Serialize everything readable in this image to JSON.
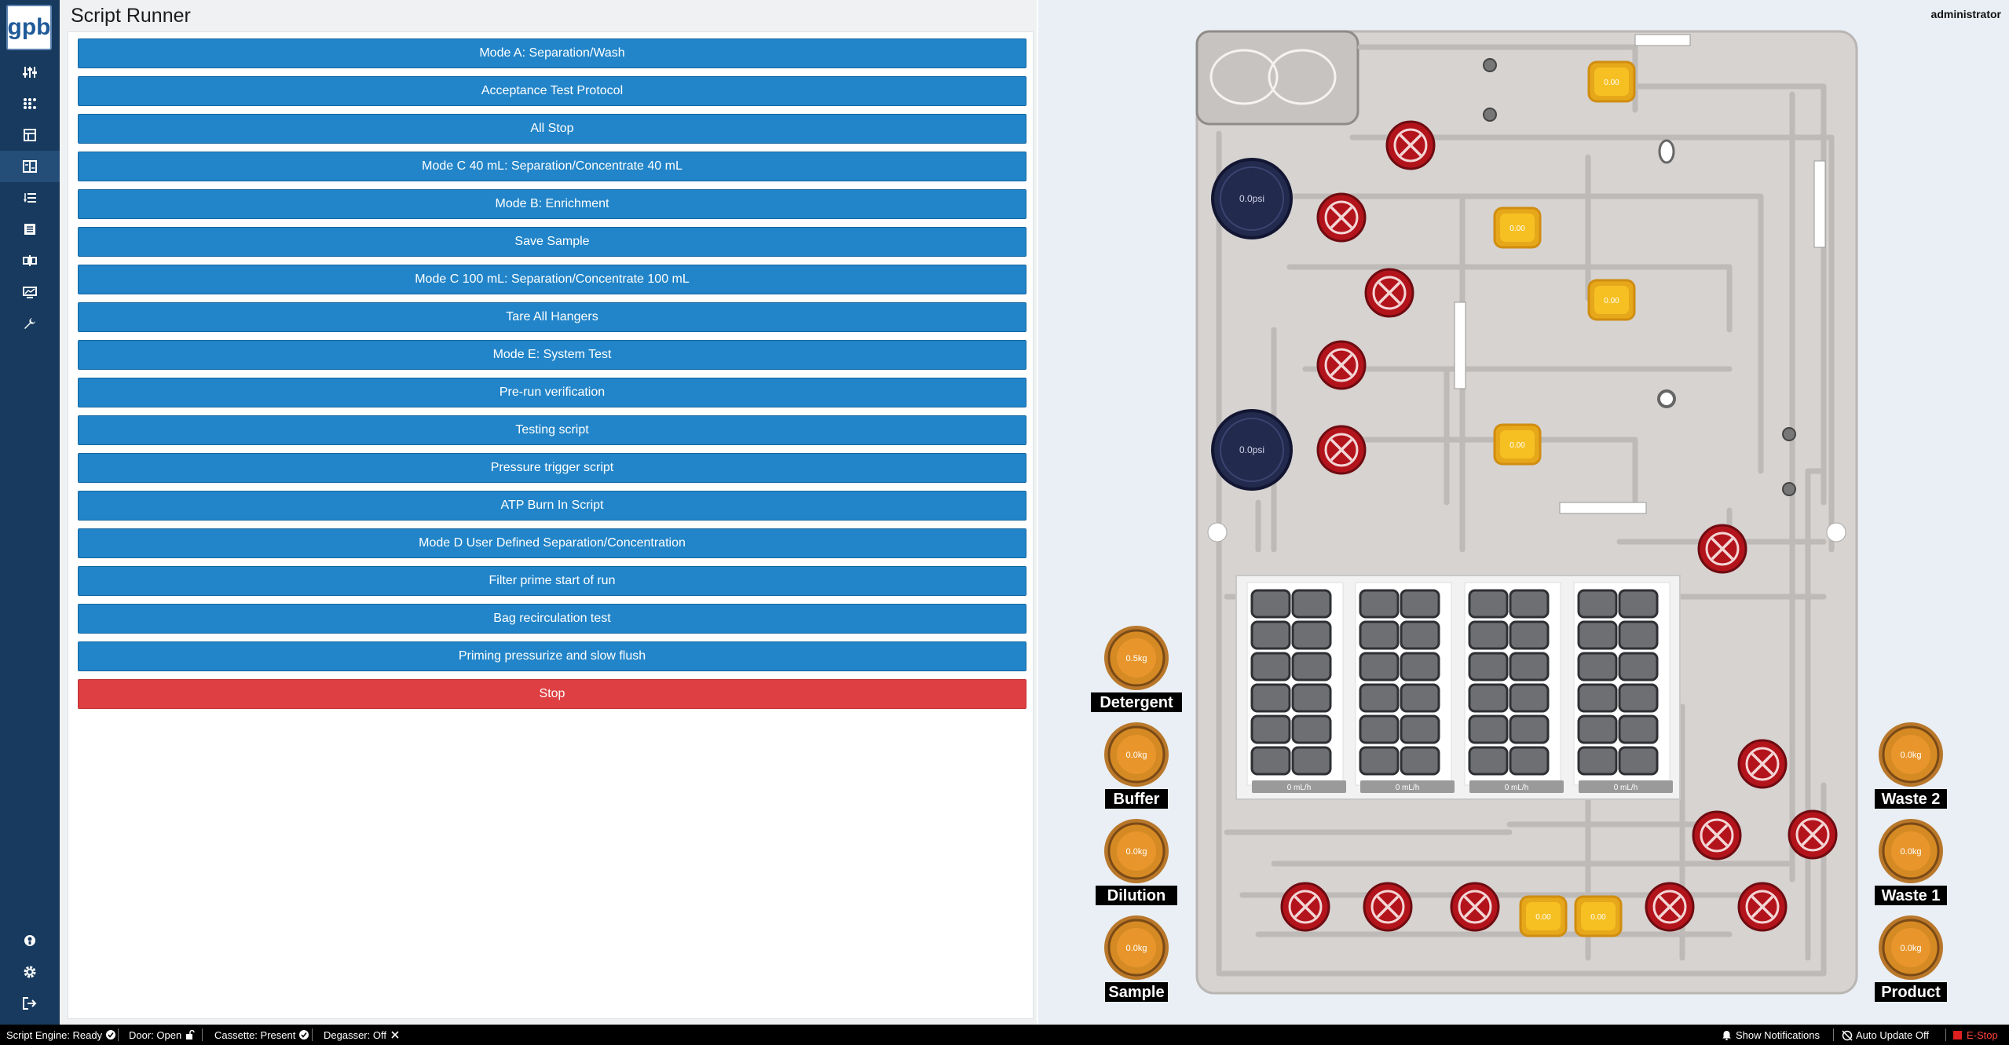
{
  "app": {
    "logo_text": "gpb",
    "title": "Script Runner",
    "user": "administrator"
  },
  "sidebar": {
    "items": [
      {
        "icon": "sliders-icon"
      },
      {
        "icon": "grid-dots-icon"
      },
      {
        "icon": "table-icon"
      },
      {
        "icon": "script-runner-icon",
        "active": true
      },
      {
        "icon": "list-order-icon"
      },
      {
        "icon": "document-list-icon"
      },
      {
        "icon": "compare-icon"
      },
      {
        "icon": "monitor-chart-icon"
      },
      {
        "icon": "wrench-icon"
      }
    ],
    "bottom_items": [
      {
        "icon": "user-icon"
      },
      {
        "icon": "gear-icon"
      },
      {
        "icon": "logout-icon"
      }
    ]
  },
  "scripts": [
    "Mode A: Separation/Wash",
    "Acceptance Test Protocol",
    "All Stop",
    "Mode C 40 mL: Separation/Concentrate 40 mL",
    "Mode B: Enrichment",
    "Save Sample",
    "Mode C 100 mL: Separation/Concentrate 100 mL",
    "Tare All Hangers",
    "Mode E: System Test",
    "Pre-run verification",
    "Testing script",
    "Pressure trigger script",
    "ATP Burn In Script",
    "Mode D User Defined Separation/Concentration",
    "Filter prime start of run",
    "Bag recirculation test",
    "Priming pressurize and slow flush"
  ],
  "stop_label": "Stop",
  "cassette": {
    "pressure_sensors": [
      "0.0psi",
      "0.0psi"
    ],
    "pumps": [
      "0.00",
      "0.00",
      "0.00",
      "0.00",
      "0.00",
      "0.00"
    ],
    "flow_readouts": [
      "0 mL/h",
      "0 mL/h",
      "0 mL/h",
      "0 mL/h"
    ],
    "hangers_left": [
      {
        "label": "Detergent",
        "value": "0.5kg"
      },
      {
        "label": "Buffer",
        "value": "0.0kg"
      },
      {
        "label": "Dilution",
        "value": "0.0kg"
      },
      {
        "label": "Sample",
        "value": "0.0kg"
      }
    ],
    "hangers_right": [
      {
        "label": "Waste 2",
        "value": "0.0kg"
      },
      {
        "label": "Waste 1",
        "value": "0.0kg"
      },
      {
        "label": "Product",
        "value": "0.0kg"
      }
    ],
    "colors": {
      "valve": "#b3141c",
      "pump": "#f6c022",
      "hanger": "#d68a24",
      "sensor": "#222a4d",
      "cassette": "#d6d3d1"
    }
  },
  "status": {
    "script_engine": "Script Engine: Ready",
    "door": "Door: Open",
    "cassette": "Cassette: Present",
    "degasser": "Degasser: Off",
    "notifications": "Show Notifications",
    "auto_update": "Auto Update Off",
    "estop": "E-Stop"
  }
}
